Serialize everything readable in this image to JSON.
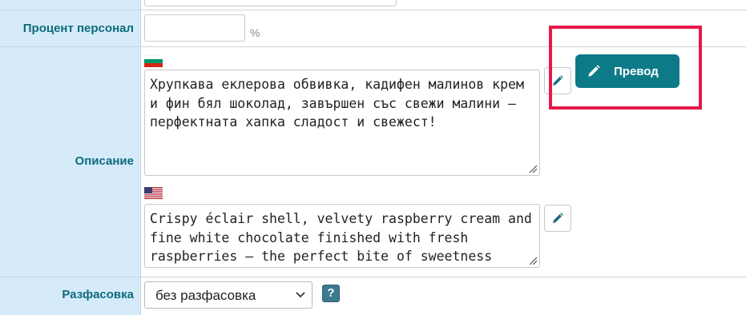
{
  "rows": {
    "percent_staff": {
      "label": "Процент персонал",
      "value": "",
      "unit": "%"
    },
    "description": {
      "label": "Описание",
      "bg": {
        "flag": "bulgarian-flag",
        "text": "Хрупкава еклерова обвивка, кадифен малинов крем и фин бял шоколад, завършен със свежи малини – перфектната хапка сладост и свежест!"
      },
      "en": {
        "flag": "us-flag",
        "text": "Crispy éclair shell, velvety raspberry cream and fine white chocolate finished with fresh raspberries – the perfect bite of sweetness"
      }
    },
    "packaging": {
      "label": "Разфасовка",
      "selected": "без разфасовка",
      "help": "?"
    }
  },
  "translate_button": {
    "label": "Превод",
    "icon": "pencil-icon"
  },
  "colors": {
    "label_column_bg": "#d6ebfa",
    "label_text": "#0d6b7b",
    "button_bg": "#0d7a87",
    "highlight": "#e6194b"
  }
}
